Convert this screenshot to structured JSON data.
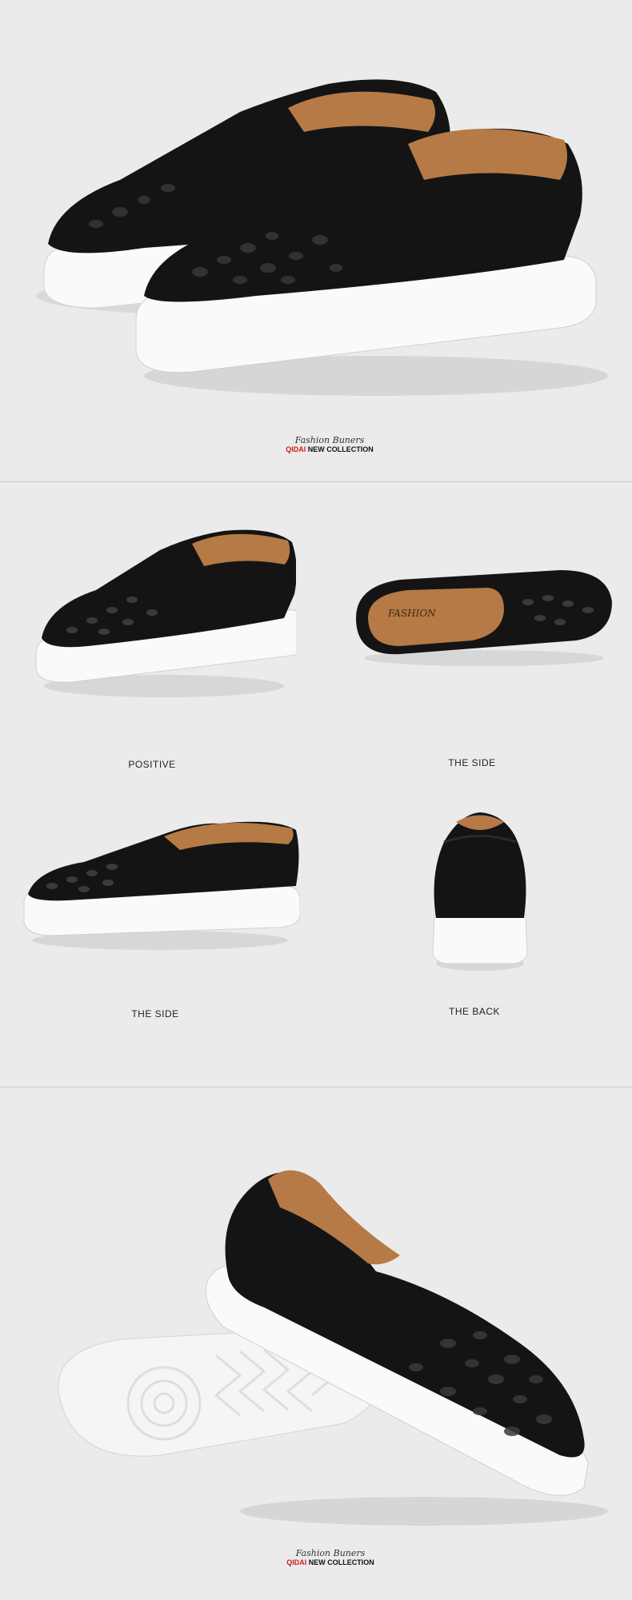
{
  "colors": {
    "background": "#ebebeb",
    "divider": "#c8c8c8",
    "upper": "#141414",
    "sole": "#fafafa",
    "lining": "#b57a45",
    "brand_red": "#d11b1b"
  },
  "hero_top": {
    "brand": {
      "script": "Fashion Buners",
      "red": "QIDAI",
      "black": "NEW COLLECTION"
    }
  },
  "views": [
    {
      "label": "POSITIVE"
    },
    {
      "label": "THE SIDE"
    },
    {
      "label": "THE SIDE"
    },
    {
      "label": "THE BACK"
    }
  ],
  "insole_text": "FASHION",
  "hero_bottom": {
    "brand": {
      "script": "Fashion Buners",
      "red": "QIDAI",
      "black": "NEW COLLECTION"
    }
  }
}
